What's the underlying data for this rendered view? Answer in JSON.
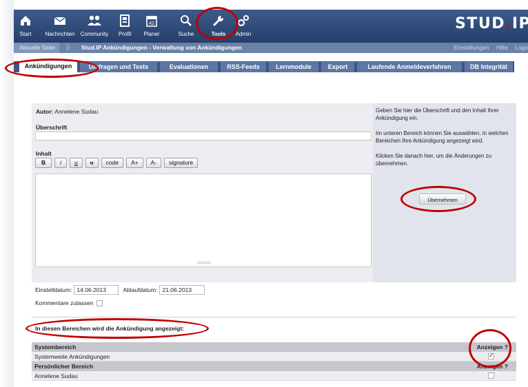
{
  "app": {
    "brand_main": "STUD",
    "brand_dot": ".",
    "brand_end": "IP"
  },
  "nav": {
    "items": [
      {
        "label": "Start",
        "icon": "home-icon"
      },
      {
        "label": "Nachrichten",
        "icon": "mail-icon"
      },
      {
        "label": "Community",
        "icon": "people-icon"
      },
      {
        "label": "Profil",
        "icon": "profile-icon"
      },
      {
        "label": "Planer",
        "icon": "calendar-icon"
      },
      {
        "label": "Suche",
        "icon": "search-icon"
      },
      {
        "label": "Tools",
        "icon": "wrench-icon"
      },
      {
        "label": "Admin",
        "icon": "gears-icon"
      }
    ]
  },
  "breadcrumb": {
    "current_label": "Aktuelle Seite",
    "title": "Stud.IP Ankündigungen - Verwaltung von Ankündigungen",
    "links": [
      "Einstellungen",
      "Hilfe",
      "Logo"
    ]
  },
  "tabs": [
    "Ankündigungen",
    "Umfragen und Tests",
    "Evaluationen",
    "RSS-Feeds",
    "Lernmodule",
    "Export",
    "Laufende Anmeldeverfahren",
    "DB Integrität"
  ],
  "editor": {
    "author_label": "Autor:",
    "author_name": "Annelene Sudau",
    "heading_label": "Überschrift",
    "heading_value": "",
    "content_label": "Inhalt",
    "content_value": "",
    "toolbar": [
      "B",
      "i",
      "u",
      "u",
      "code",
      "A+",
      "A-",
      "signature"
    ]
  },
  "help": {
    "p1": "Geben Sie hier die Überschrift und den Inhalt Ihrer Ankündigung ein.",
    "p2": "Im unteren Bereich können Sie auswählen, in welchen Bereichen Ihre Ankündigung angezeigt wird.",
    "p3": "Klicken Sie danach hier, um die Änderungen zu übernehmen.",
    "apply_button": "Übernehmen"
  },
  "dates": {
    "start_label": "Einstelldatum:",
    "start_value": "14.06.2013",
    "end_label": "Ablaufdatum:",
    "end_value": "21.06.2013"
  },
  "comments": {
    "label": "Kommentare zulassen",
    "checked": false
  },
  "areas": {
    "title": "In diesen Bereichen wird die Ankündigung angezeigt:",
    "groups": [
      {
        "header": "Systembereich",
        "show_label": "Anzeigen ?",
        "rows": [
          {
            "name": "Systemweite Ankündigungen",
            "checked": true
          }
        ]
      },
      {
        "header": "Persönlicher Bereich",
        "show_label": "Anzeigen ?",
        "rows": [
          {
            "name": "Annelene Sudau",
            "checked": false
          }
        ]
      }
    ]
  },
  "colors": {
    "nav_bg": "#2f4a7a",
    "tab_bg": "#5d77a4",
    "annotation_red": "#c00000"
  }
}
